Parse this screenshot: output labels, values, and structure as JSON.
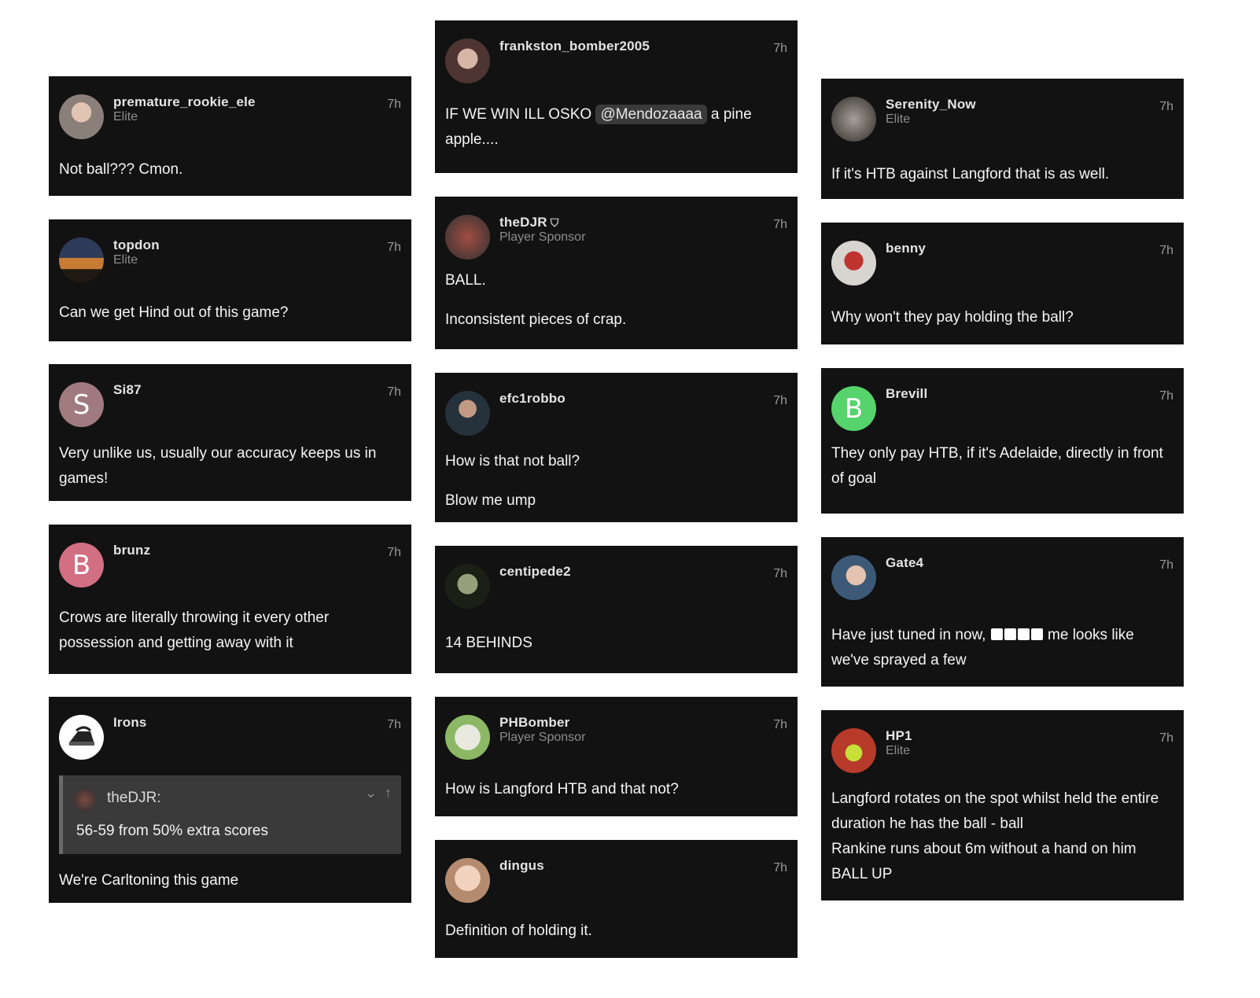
{
  "time_label": "7h",
  "columns": {
    "left": [
      {
        "username": "premature_rookie_ele",
        "badge": "Elite",
        "body": [
          "Not ball??? Cmon."
        ],
        "avatar": "photo-avatar",
        "avatar_color": "#8b7f79"
      },
      {
        "username": "topdon",
        "badge": "Elite",
        "body": [
          "Can we get Hind out of this game?"
        ],
        "avatar": "arch-photo-avatar",
        "avatar_color": "#c77b33"
      },
      {
        "username": "Si87",
        "badge": "",
        "body": [
          "Very unlike us, usually our accuracy keeps us in games!"
        ],
        "avatar_letter": "S",
        "avatar_color": "#a07a7f"
      },
      {
        "username": "brunz",
        "badge": "",
        "body": [
          "Crows are literally throwing it every other possession and getting away with it"
        ],
        "avatar_letter": "B",
        "avatar_color": "#d26f83"
      },
      {
        "username": "Irons",
        "badge": "",
        "body": [
          "We're Carltoning this game"
        ],
        "avatar": "iron-icon",
        "avatar_color": "#ffffff",
        "quote": {
          "user": "theDJR:",
          "text": "56-59 from 50% extra scores"
        }
      }
    ],
    "middle": [
      {
        "username": "frankston_bomber2005",
        "badge": "",
        "body_mention": {
          "before": "IF WE WIN ILL OSKO ",
          "mention": "@Mendozaaaa",
          "after": " a pine apple...."
        },
        "avatar": "photo-avatar",
        "avatar_color": "#a98f85"
      },
      {
        "username": "theDJR",
        "badge": "Player Sponsor",
        "body": [
          "BALL.",
          "Inconsistent pieces of crap."
        ],
        "avatar": "photo-avatar",
        "avatar_color": "#7b4b44"
      },
      {
        "username": "efc1robbo",
        "badge": "",
        "body": [
          "How is that not ball?",
          "Blow me ump"
        ],
        "avatar": "photo-avatar",
        "avatar_color": "#364552"
      },
      {
        "username": "centipede2",
        "badge": "",
        "body": [
          "14 BEHINDS"
        ],
        "avatar": "photo-avatar",
        "avatar_color": "#6d735a"
      },
      {
        "username": "PHBomber",
        "badge": "Player Sponsor",
        "body": [
          "How is Langford HTB and that not?"
        ],
        "avatar": "cartoon-avatar",
        "avatar_color": "#d2d2c8"
      },
      {
        "username": "dingus",
        "badge": "",
        "body": [
          "Definition of holding it."
        ],
        "avatar": "photo-avatar",
        "avatar_color": "#e8c9b6"
      }
    ],
    "right": [
      {
        "username": "Serenity_Now",
        "badge": "Elite",
        "body": [
          "If it's HTB against Langford that is as well."
        ],
        "avatar": "photo-avatar",
        "avatar_color": "#6d6258"
      },
      {
        "username": "benny",
        "badge": "",
        "body": [
          "Why won't they pay holding the ball?"
        ],
        "avatar": "photo-avatar",
        "avatar_color": "#b9b4b0"
      },
      {
        "username": "Brevill",
        "badge": "",
        "body": [
          "They only pay HTB, if it's Adelaide, directly in front of goal"
        ],
        "avatar_letter": "B",
        "avatar_color": "#56d36b"
      },
      {
        "username": "Gate4",
        "badge": "",
        "body_censor": {
          "before": "Have just tuned in now, ",
          "after": " me looks like we've sprayed a few",
          "blocks": 4
        },
        "avatar": "photo-avatar",
        "avatar_color": "#4f6f8c"
      },
      {
        "username": "HP1",
        "badge": "Elite",
        "body": [
          "Langford rotates on the spot whilst held the entire duration he has the ball - ball",
          "Rankine runs about 6m without a hand on him",
          "BALL UP"
        ],
        "avatar": "photo-avatar",
        "avatar_color": "#c43c29"
      }
    ]
  }
}
